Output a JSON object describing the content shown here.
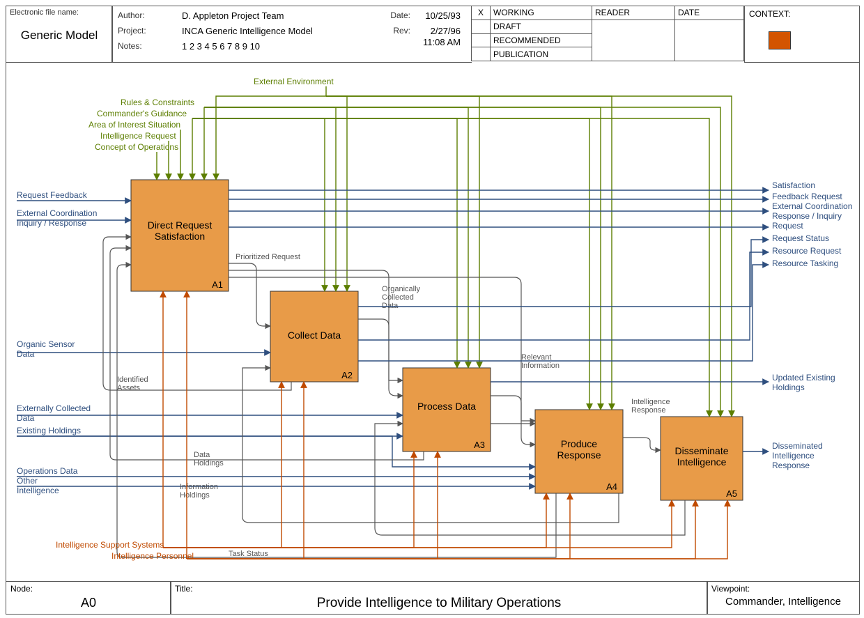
{
  "header": {
    "filename_label": "Electronic file name:",
    "filename_value": "Generic Model",
    "author_label": "Author:",
    "author_value": "D. Appleton Project Team",
    "project_label": "Project:",
    "project_value": "INCA Generic Intelligence Model",
    "notes_label": "Notes:",
    "notes_value": "1  2  3  4  5  6  7  8  9  10",
    "date_label": "Date:",
    "date_value": "10/25/93",
    "rev_label": "Rev:",
    "rev_value": "2/27/96",
    "rev_time": "11:08 AM",
    "x_col": "X",
    "status_working": "WORKING",
    "status_draft": "DRAFT",
    "status_recommended": "RECOMMENDED",
    "status_publication": "PUBLICATION",
    "reader_label": "READER",
    "date_col": "DATE",
    "context_label": "CONTEXT:"
  },
  "footer": {
    "node_label": "Node:",
    "node_value": "A0",
    "title_label": "Title:",
    "title_value": "Provide Intelligence to Military Operations",
    "viewpoint_label": "Viewpoint:",
    "viewpoint_value": "Commander, Intelligence"
  },
  "boxes": {
    "a1": {
      "title": "Direct Request Satisfaction",
      "id": "A1"
    },
    "a2": {
      "title": "Collect Data",
      "id": "A2"
    },
    "a3": {
      "title": "Process Data",
      "id": "A3"
    },
    "a4": {
      "title": "Produce Response",
      "id": "A4"
    },
    "a5": {
      "title": "Disseminate Intelligence",
      "id": "A5"
    }
  },
  "controls": {
    "ext_env": "External Environment",
    "rules": "Rules & Constraints",
    "cmd_guide": "Commander's Guidance",
    "aoi": "Area of Interest Situation",
    "intel_req": "Intelligence Request",
    "conops": "Concept of Operations"
  },
  "left_inputs": {
    "req_fb": "Request Feedback",
    "ext_coord": "External Coordination Inquiry / Response",
    "org_sensor": "Organic Sensor Data",
    "ext_collected": "Externally Collected Data",
    "existing": "Existing Holdings",
    "ops_data": "Operations Data",
    "other_intel": "Other Intelligence"
  },
  "mechanisms": {
    "iss": "Intelligence Support Systems",
    "ip": "Intelligence Personnel"
  },
  "arrow_labels": {
    "prioritized": "Prioritized Request",
    "org_collected": "Organically Collected Data",
    "relevant": "Relevant Information",
    "intel_resp": "Intelligence Response",
    "identified": "Identified Assets",
    "data_hold": "Data Holdings",
    "info_hold": "Information Holdings",
    "task_status": "Task Status"
  },
  "right_outputs": {
    "satisfaction": "Satisfaction",
    "fb_req": "Feedback Request",
    "ext_coord_out": "External Coordination Response / Inquiry",
    "request": "Request",
    "req_status": "Request Status",
    "res_req": "Resource Request",
    "res_task": "Resource Tasking",
    "updated": "Updated Existing Holdings",
    "dissem": "Disseminated Intelligence Response"
  }
}
